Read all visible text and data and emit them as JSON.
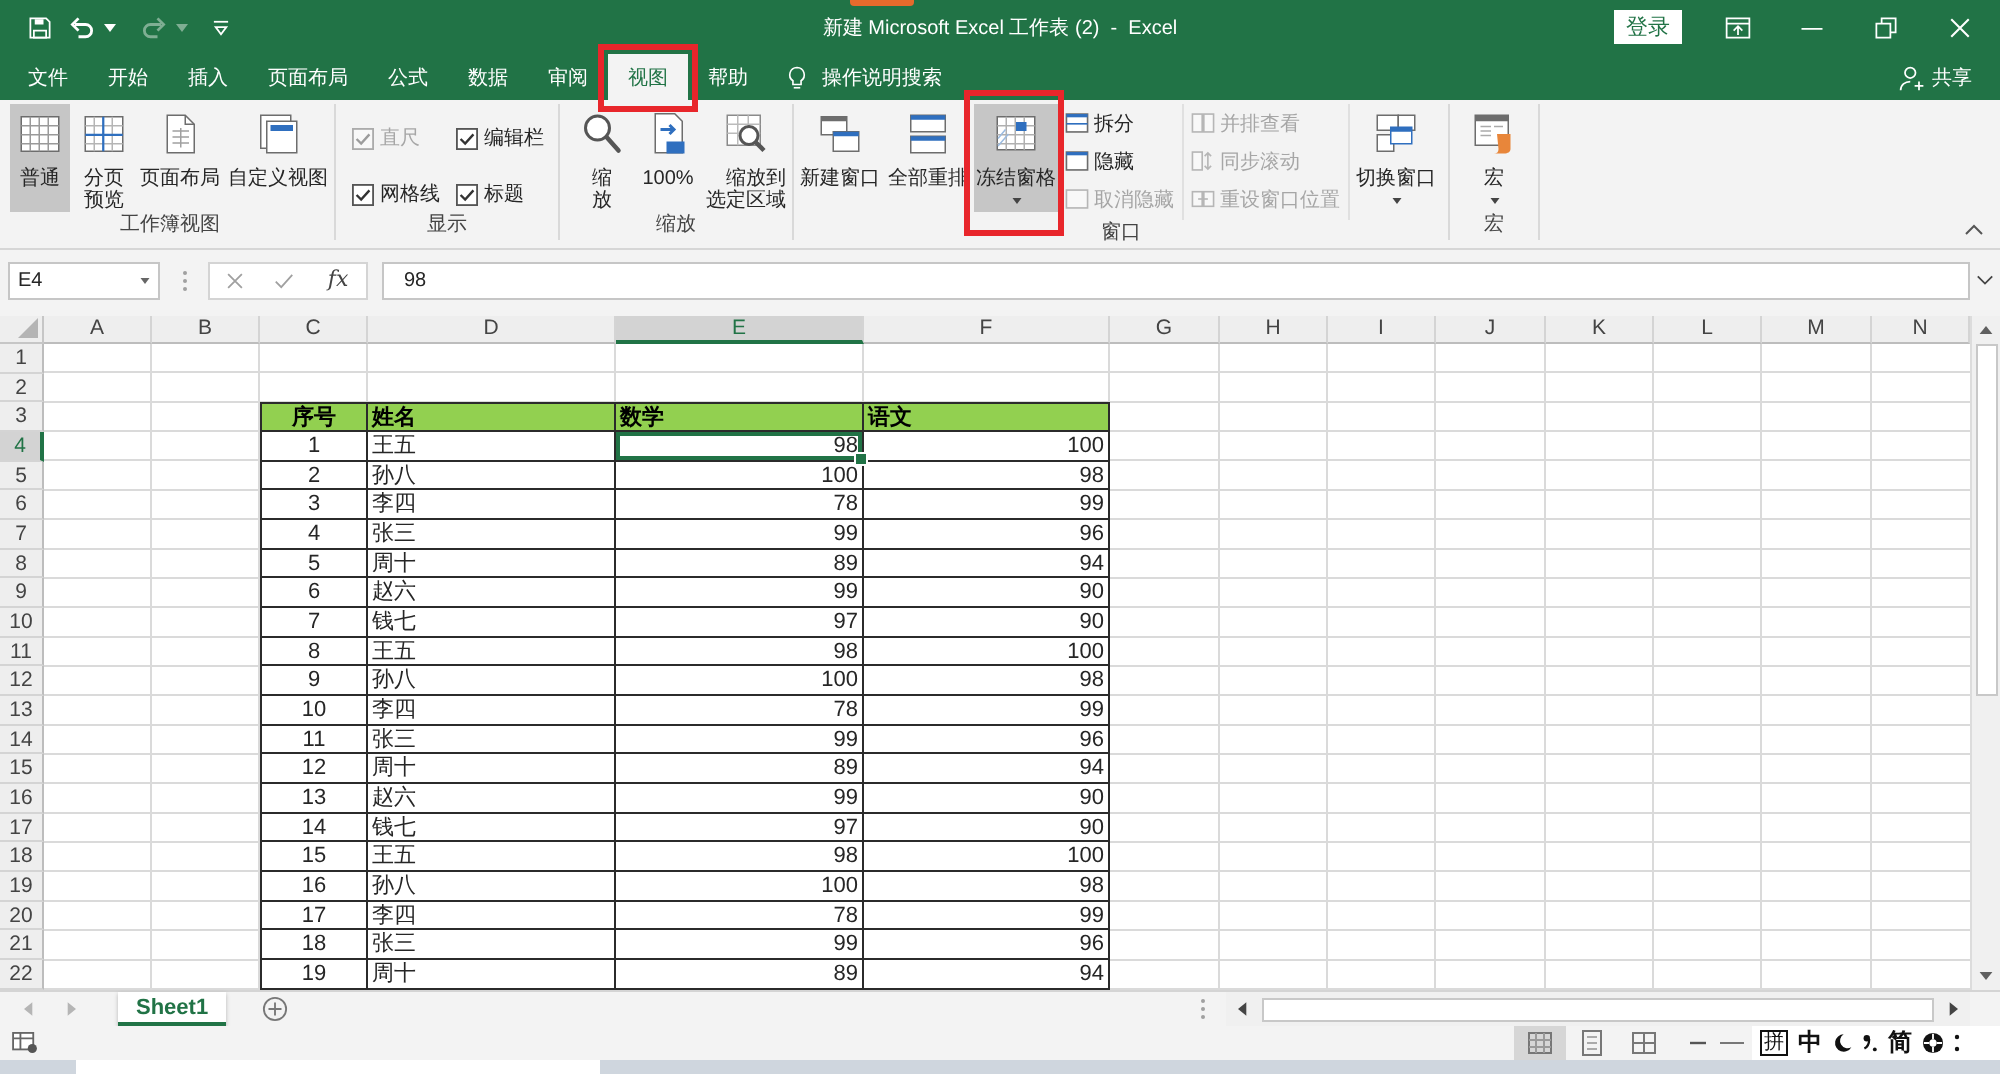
{
  "title_bar": {
    "title": "新建 Microsoft Excel 工作表 (2)  -  Excel",
    "sign_in": "登录"
  },
  "tabs": [
    {
      "label": "文件",
      "selected": false,
      "highlighted": false
    },
    {
      "label": "开始",
      "selected": false,
      "highlighted": false
    },
    {
      "label": "插入",
      "selected": false,
      "highlighted": false
    },
    {
      "label": "页面布局",
      "selected": false,
      "highlighted": false
    },
    {
      "label": "公式",
      "selected": false,
      "highlighted": false
    },
    {
      "label": "数据",
      "selected": false,
      "highlighted": false
    },
    {
      "label": "审阅",
      "selected": false,
      "highlighted": false
    },
    {
      "label": "视图",
      "selected": true,
      "highlighted": true
    },
    {
      "label": "帮助",
      "selected": false,
      "highlighted": false
    }
  ],
  "tell_me": {
    "label": "操作说明搜索"
  },
  "share": {
    "label": "共享"
  },
  "ribbon": {
    "groups": [
      {
        "label": "工作簿视图",
        "items": [
          {
            "kind": "large",
            "label": "普通",
            "selected": true,
            "dropdown": false,
            "highlighted": false
          },
          {
            "kind": "large",
            "label": "分页预览",
            "selected": false,
            "dropdown": false,
            "highlighted": false
          },
          {
            "kind": "large",
            "label": "页面布局",
            "selected": false,
            "dropdown": false,
            "highlighted": false
          },
          {
            "kind": "large",
            "label": "自定义视图",
            "selected": false,
            "dropdown": false,
            "highlighted": false
          }
        ]
      },
      {
        "label": "显示",
        "items": [
          {
            "kind": "check",
            "label": "直尺",
            "checked": true,
            "disabled": true
          },
          {
            "kind": "check",
            "label": "编辑栏",
            "checked": true,
            "disabled": false
          },
          {
            "kind": "check",
            "label": "网格线",
            "checked": true,
            "disabled": false
          },
          {
            "kind": "check",
            "label": "标题",
            "checked": true,
            "disabled": false
          }
        ]
      },
      {
        "label": "缩放",
        "items": [
          {
            "kind": "large",
            "label": "缩放",
            "selected": false,
            "dropdown": false,
            "highlighted": false
          },
          {
            "kind": "large",
            "label": "100%",
            "selected": false,
            "dropdown": false,
            "highlighted": false
          },
          {
            "kind": "large",
            "label": "缩放到选定区域",
            "selected": false,
            "dropdown": false,
            "highlighted": false
          }
        ]
      },
      {
        "label": "窗口",
        "items": [
          {
            "kind": "large",
            "label": "新建窗口",
            "selected": false,
            "dropdown": false,
            "highlighted": false
          },
          {
            "kind": "large",
            "label": "全部重排",
            "selected": false,
            "dropdown": false,
            "highlighted": false
          },
          {
            "kind": "large",
            "label": "冻结窗格",
            "selected": true,
            "dropdown": true,
            "highlighted": true
          },
          {
            "kind": "small",
            "label": "拆分",
            "disabled": false
          },
          {
            "kind": "small",
            "label": "隐藏",
            "disabled": false
          },
          {
            "kind": "small",
            "label": "取消隐藏",
            "disabled": true
          },
          {
            "kind": "small",
            "label": "并排查看",
            "disabled": true
          },
          {
            "kind": "small",
            "label": "同步滚动",
            "disabled": true
          },
          {
            "kind": "small",
            "label": "重设窗口位置",
            "disabled": true
          },
          {
            "kind": "large",
            "label": "切换窗口",
            "selected": false,
            "dropdown": true,
            "highlighted": false
          }
        ]
      },
      {
        "label": "宏",
        "items": [
          {
            "kind": "large",
            "label": "宏",
            "selected": false,
            "dropdown": true,
            "highlighted": false
          }
        ]
      }
    ]
  },
  "formula_bar": {
    "name_box": "E4",
    "function_button": "fx",
    "value": "98"
  },
  "columns": [
    {
      "label": "A",
      "selected": false
    },
    {
      "label": "B",
      "selected": false
    },
    {
      "label": "C",
      "selected": false
    },
    {
      "label": "D",
      "selected": false
    },
    {
      "label": "E",
      "selected": true
    },
    {
      "label": "F",
      "selected": false
    },
    {
      "label": "G",
      "selected": false
    },
    {
      "label": "H",
      "selected": false
    },
    {
      "label": "I",
      "selected": false
    },
    {
      "label": "J",
      "selected": false
    },
    {
      "label": "K",
      "selected": false
    },
    {
      "label": "L",
      "selected": false
    },
    {
      "label": "M",
      "selected": false
    },
    {
      "label": "N",
      "selected": false
    }
  ],
  "rows": [
    {
      "label": "1",
      "selected": false
    },
    {
      "label": "2",
      "selected": false
    },
    {
      "label": "3",
      "selected": false
    },
    {
      "label": "4",
      "selected": true
    },
    {
      "label": "5",
      "selected": false
    },
    {
      "label": "6",
      "selected": false
    },
    {
      "label": "7",
      "selected": false
    },
    {
      "label": "8",
      "selected": false
    },
    {
      "label": "9",
      "selected": false
    },
    {
      "label": "10",
      "selected": false
    },
    {
      "label": "11",
      "selected": false
    },
    {
      "label": "12",
      "selected": false
    },
    {
      "label": "13",
      "selected": false
    },
    {
      "label": "14",
      "selected": false
    },
    {
      "label": "15",
      "selected": false
    },
    {
      "label": "16",
      "selected": false
    },
    {
      "label": "17",
      "selected": false
    },
    {
      "label": "18",
      "selected": false
    },
    {
      "label": "19",
      "selected": false
    },
    {
      "label": "20",
      "selected": false
    },
    {
      "label": "21",
      "selected": false
    },
    {
      "label": "22",
      "selected": false
    }
  ],
  "table": {
    "header": [
      "序号",
      "姓名",
      "数学",
      "语文"
    ],
    "rows": [
      [
        "1",
        "王五",
        "98",
        "100"
      ],
      [
        "2",
        "孙八",
        "100",
        "98"
      ],
      [
        "3",
        "李四",
        "78",
        "99"
      ],
      [
        "4",
        "张三",
        "99",
        "96"
      ],
      [
        "5",
        "周十",
        "89",
        "94"
      ],
      [
        "6",
        "赵六",
        "99",
        "90"
      ],
      [
        "7",
        "钱七",
        "97",
        "90"
      ],
      [
        "8",
        "王五",
        "98",
        "100"
      ],
      [
        "9",
        "孙八",
        "100",
        "98"
      ],
      [
        "10",
        "李四",
        "78",
        "99"
      ],
      [
        "11",
        "张三",
        "99",
        "96"
      ],
      [
        "12",
        "周十",
        "89",
        "94"
      ],
      [
        "13",
        "赵六",
        "99",
        "90"
      ],
      [
        "14",
        "钱七",
        "97",
        "90"
      ],
      [
        "15",
        "王五",
        "98",
        "100"
      ],
      [
        "16",
        "孙八",
        "100",
        "98"
      ],
      [
        "17",
        "李四",
        "78",
        "99"
      ],
      [
        "18",
        "张三",
        "99",
        "96"
      ],
      [
        "19",
        "周十",
        "89",
        "94"
      ]
    ]
  },
  "sheets": [
    {
      "label": "Sheet1",
      "selected": true
    }
  ],
  "status_bar": {
    "view_buttons": [
      {
        "selected": true
      },
      {
        "selected": false
      },
      {
        "selected": false
      }
    ]
  },
  "ime_bar": {
    "mode": "拼",
    "language": "中",
    "script": "简"
  }
}
